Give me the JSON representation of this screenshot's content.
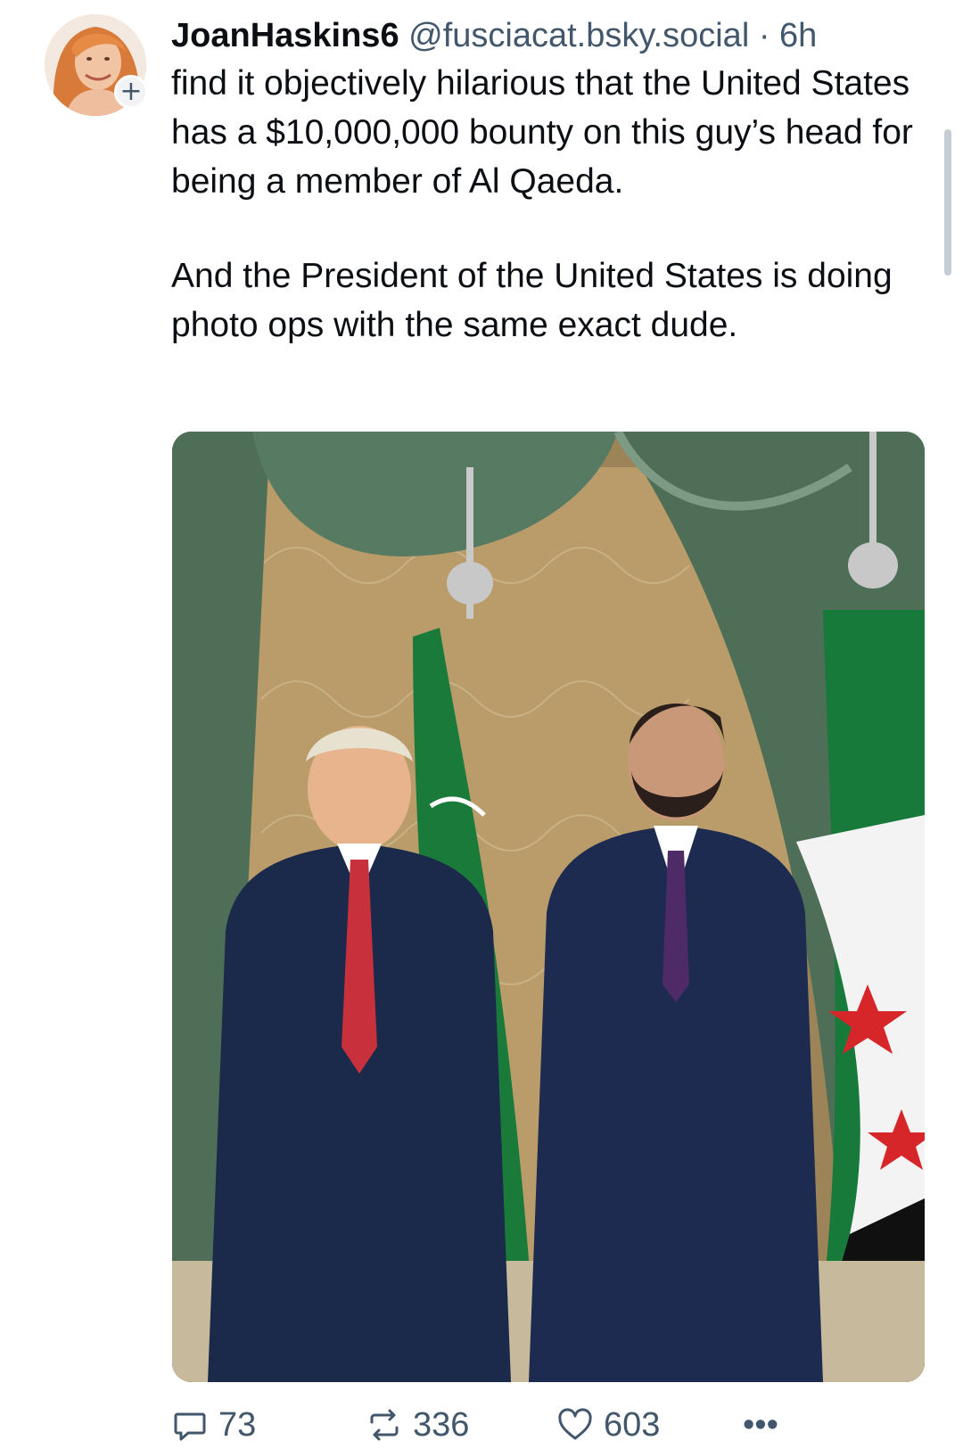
{
  "post": {
    "author": {
      "display_name": "JoanHaskins6",
      "handle": "@fusciacat.bsky.social",
      "separator": "·",
      "time": "6h"
    },
    "follow_badge": "+",
    "text": {
      "paragraph_1": "find it objectively hilarious that the United States has a $10,000,000 bounty on this guy’s head for being a member of Al Qaeda.",
      "paragraph_2": "And the President of the United States is doing photo ops with the same exact dude."
    },
    "image": {
      "icon": "photo"
    }
  },
  "actions": {
    "reply_count": "73",
    "repost_count": "336",
    "like_count": "603",
    "more_label": "•••"
  },
  "colors": {
    "text_primary": "#0b0f14",
    "text_secondary": "#42576c",
    "background": "#ffffff"
  }
}
